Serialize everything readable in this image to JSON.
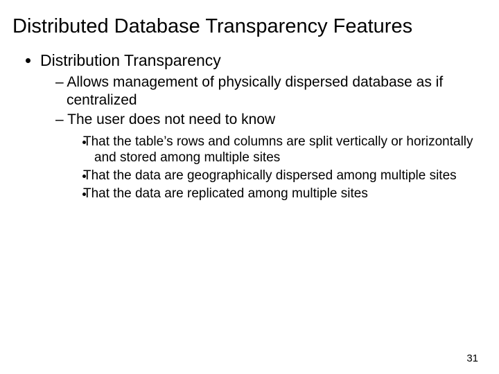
{
  "title": "Distributed Database Transparency Features",
  "bullets": {
    "l1": {
      "a": "Distribution Transparency"
    },
    "l2": {
      "a": "Allows management of physically dispersed database as if centralized",
      "b": "The user does not need to know"
    },
    "l3": {
      "a": "That the table’s rows and columns are split vertically or horizontally and stored among multiple sites",
      "b": "That the data are geographically dispersed among multiple sites",
      "c": "That the data are replicated among multiple sites"
    }
  },
  "page_number": "31"
}
